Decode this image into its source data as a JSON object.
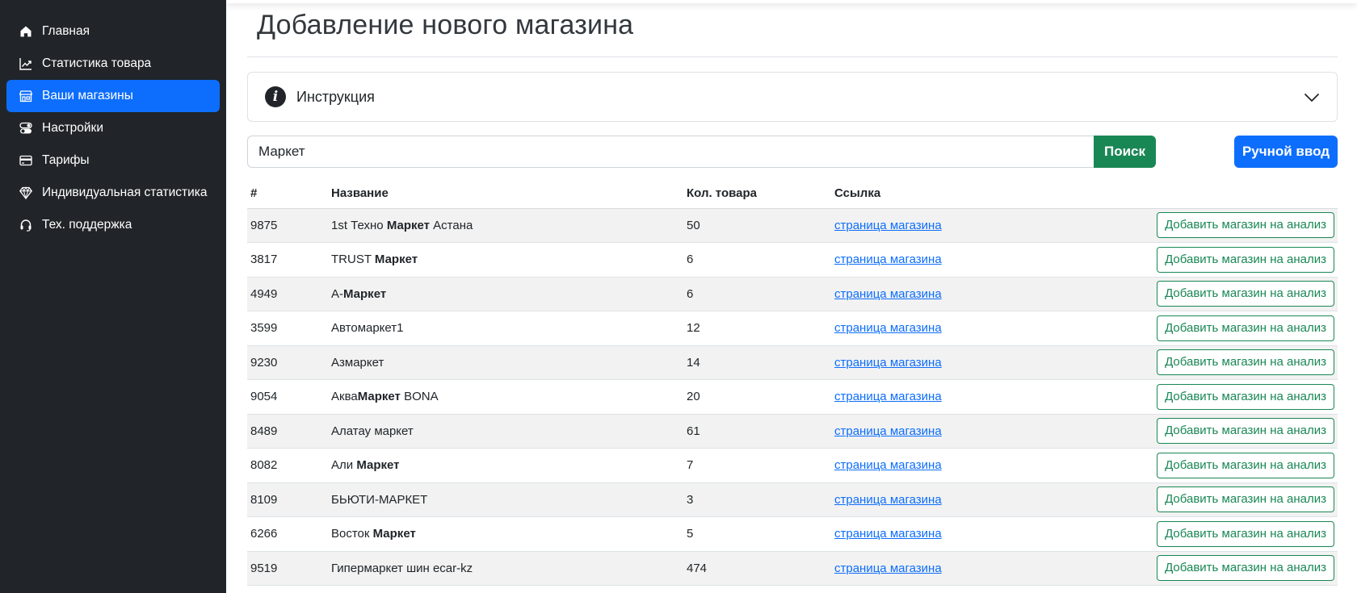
{
  "sidebar": {
    "items": [
      {
        "label": "Главная",
        "icon": "home-icon",
        "active": false
      },
      {
        "label": "Статистика товара",
        "icon": "chart-line-icon",
        "active": false
      },
      {
        "label": "Ваши магазины",
        "icon": "shop-icon",
        "active": true
      },
      {
        "label": "Настройки",
        "icon": "toggles-icon",
        "active": false
      },
      {
        "label": "Тарифы",
        "icon": "card-icon",
        "active": false
      },
      {
        "label": "Индивидуальная статистика",
        "icon": "gem-icon",
        "active": false
      },
      {
        "label": "Тех. поддержка",
        "icon": "headset-icon",
        "active": false
      }
    ]
  },
  "page": {
    "title": "Добавление нового магазина"
  },
  "instruction": {
    "label": "Инструкция",
    "icon": "info-icon",
    "expanded": false
  },
  "search": {
    "value": "Маркет",
    "button_label": "Поиск",
    "manual_label": "Ручной ввод"
  },
  "table": {
    "headers": {
      "id": "#",
      "name": "Название",
      "qty": "Кол. товара",
      "link": "Ссылка"
    },
    "link_text": "страница магазина",
    "action_label": "Добавить магазин на анализ",
    "rows": [
      {
        "id": "9875",
        "name": [
          {
            "t": "1st Техно "
          },
          {
            "t": "Маркет",
            "b": true
          },
          {
            "t": " Астана"
          }
        ],
        "qty": "50"
      },
      {
        "id": "3817",
        "name": [
          {
            "t": "TRUST "
          },
          {
            "t": "Маркет",
            "b": true
          }
        ],
        "qty": "6"
      },
      {
        "id": "4949",
        "name": [
          {
            "t": "А-"
          },
          {
            "t": "Маркет",
            "b": true
          }
        ],
        "qty": "6"
      },
      {
        "id": "3599",
        "name": [
          {
            "t": "Автомаркет1"
          }
        ],
        "qty": "12"
      },
      {
        "id": "9230",
        "name": [
          {
            "t": "Азмаркет"
          }
        ],
        "qty": "14"
      },
      {
        "id": "9054",
        "name": [
          {
            "t": "Аква"
          },
          {
            "t": "Маркет",
            "b": true
          },
          {
            "t": " BONA"
          }
        ],
        "qty": "20"
      },
      {
        "id": "8489",
        "name": [
          {
            "t": "Алатау маркет"
          }
        ],
        "qty": "61"
      },
      {
        "id": "8082",
        "name": [
          {
            "t": "Али "
          },
          {
            "t": "Маркет",
            "b": true
          }
        ],
        "qty": "7"
      },
      {
        "id": "8109",
        "name": [
          {
            "t": "БЬЮТИ-МАРКЕТ"
          }
        ],
        "qty": "3"
      },
      {
        "id": "6266",
        "name": [
          {
            "t": "Восток "
          },
          {
            "t": "Маркет",
            "b": true
          }
        ],
        "qty": "5"
      },
      {
        "id": "9519",
        "name": [
          {
            "t": "Гипермаркет шин ecar-kz"
          }
        ],
        "qty": "474"
      },
      {
        "id": "",
        "name": [
          {
            "t": ""
          }
        ],
        "qty": ""
      }
    ]
  },
  "colors": {
    "sidebar_bg": "#212529",
    "active_bg": "#0d6efd",
    "success": "#198754",
    "link": "#0d6efd"
  }
}
